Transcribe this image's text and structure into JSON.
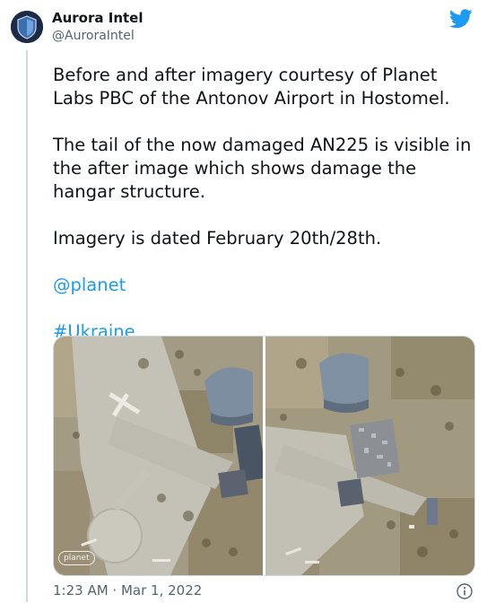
{
  "author": {
    "name": "Aurora Intel",
    "handle": "@AuroraIntel"
  },
  "tweet": {
    "paragraphs": [
      "Before and after imagery courtesy of Planet Labs PBC of the Antonov Airport in Hostomel.",
      "The tail of the now damaged AN225 is visible in the after image which shows damage the hangar structure.",
      "Imagery is dated February 20th/28th."
    ],
    "mention": "@planet",
    "hashtag": "#Ukraine"
  },
  "media": {
    "watermark": "planet"
  },
  "footer": {
    "timestamp": "1:23 AM · Mar 1, 2022"
  },
  "colors": {
    "link": "#1d9bf0",
    "text": "#0f1419",
    "secondary": "#536471"
  },
  "icons": {
    "brand": "twitter-bird-icon",
    "info": "info-icon",
    "avatar": "shield-logo-icon"
  }
}
